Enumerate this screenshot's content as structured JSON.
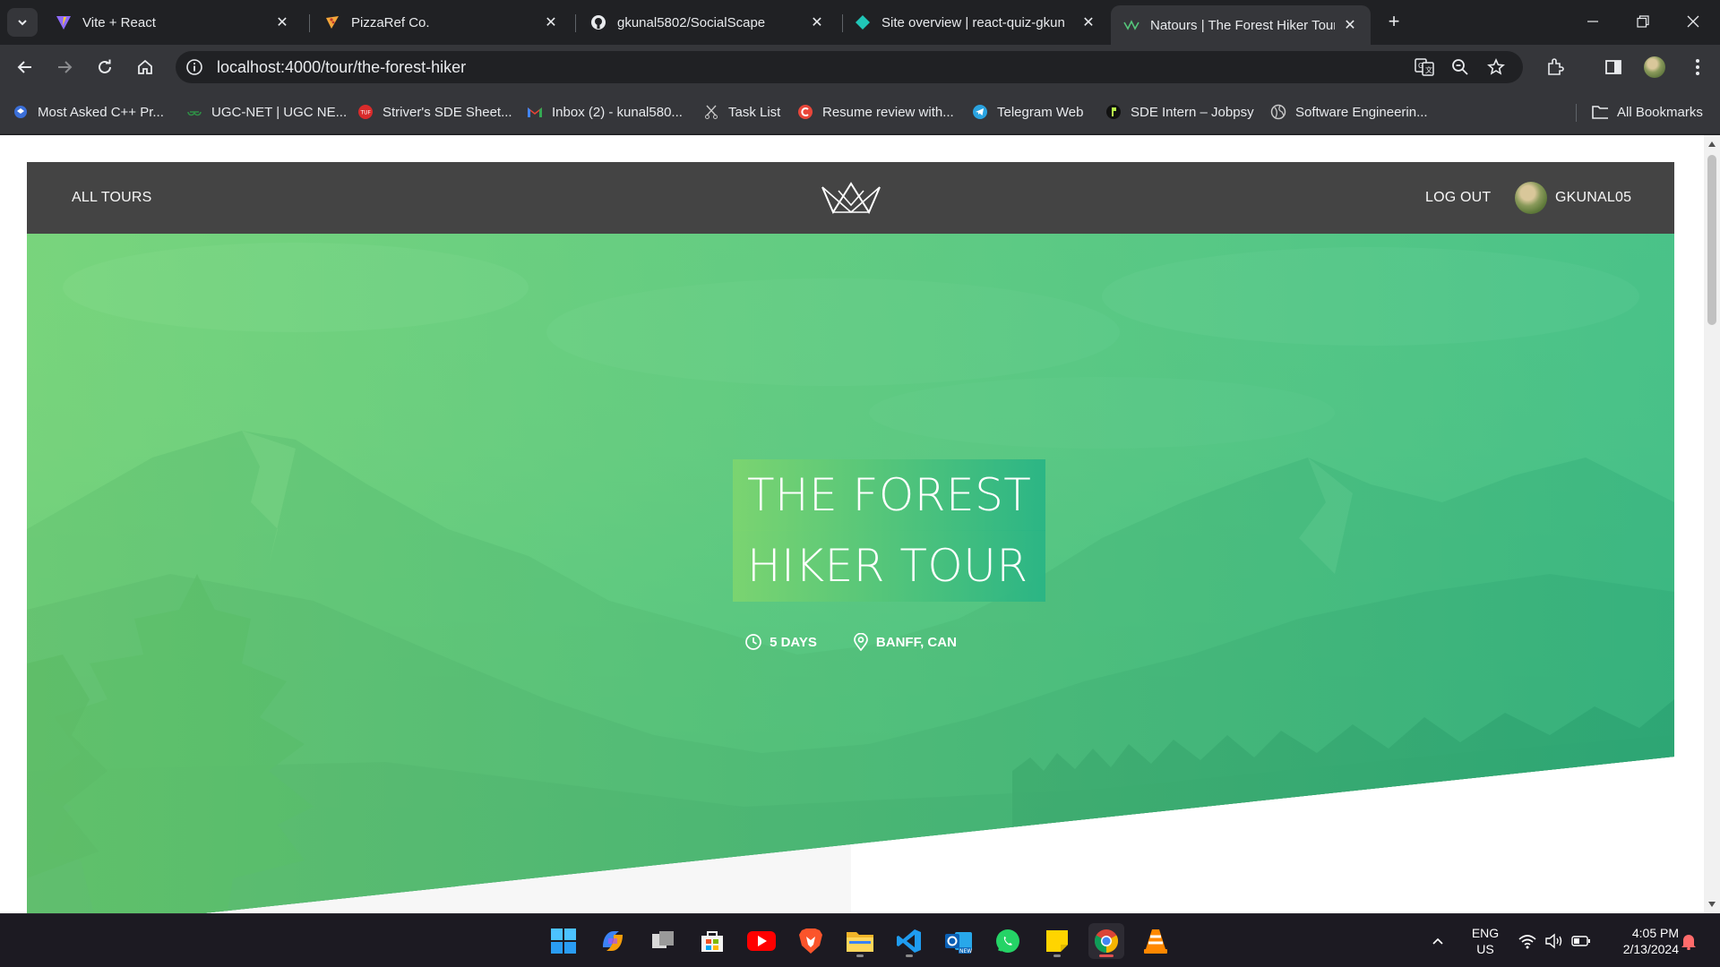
{
  "browser": {
    "tabs": [
      {
        "title": "Vite + React",
        "icon": "vite-icon"
      },
      {
        "title": "PizzaRef Co.",
        "icon": "pizza-icon"
      },
      {
        "title": "gkunal5802/SocialScape",
        "icon": "github-icon"
      },
      {
        "title": "Site overview | react-quiz-gkun",
        "icon": "netlify-icon"
      },
      {
        "title": "Natours | The Forest Hiker Tour",
        "icon": "natours-icon",
        "active": true
      }
    ],
    "url": "localhost:4000/tour/the-forest-hiker",
    "bookmarks": [
      {
        "label": "Most Asked C++ Pr...",
        "icon": "bookmark-site-icon"
      },
      {
        "label": "UGC-NET | UGC NE...",
        "icon": "gfg-icon"
      },
      {
        "label": "Striver's SDE Sheet...",
        "icon": "tuf-icon"
      },
      {
        "label": "Inbox (2) - kunal580...",
        "icon": "gmail-icon"
      },
      {
        "label": "Task List",
        "icon": "scissors-icon"
      },
      {
        "label": "Resume review with...",
        "icon": "resume-icon"
      },
      {
        "label": "Telegram Web",
        "icon": "telegram-icon"
      },
      {
        "label": "SDE Intern – Jobpsy",
        "icon": "jobpsy-icon"
      },
      {
        "label": "Software Engineerin...",
        "icon": "globe-icon"
      }
    ],
    "all_bookmarks": "All Bookmarks"
  },
  "site": {
    "nav": {
      "all_tours": "All tours",
      "log_out": "Log out",
      "user_name": "GKUNAL05"
    },
    "tour": {
      "title_line1": "The Forest",
      "title_line2": "Hiker Tour",
      "duration": "5 days",
      "location": "Banff, CAN"
    },
    "colors": {
      "primary_light": "#7dd56f",
      "primary_dark": "#28b487",
      "header_bg": "#444444"
    }
  },
  "taskbar": {
    "apps": [
      "windows-start-icon",
      "copilot-icon",
      "task-view-icon",
      "microsoft-store-icon",
      "youtube-icon",
      "brave-icon",
      "file-explorer-icon",
      "vscode-icon",
      "outlook-icon",
      "whatsapp-icon",
      "sticky-notes-icon",
      "chrome-icon",
      "vlc-icon"
    ],
    "language_line1": "ENG",
    "language_line2": "US",
    "time": "4:05 PM",
    "date": "2/13/2024"
  }
}
